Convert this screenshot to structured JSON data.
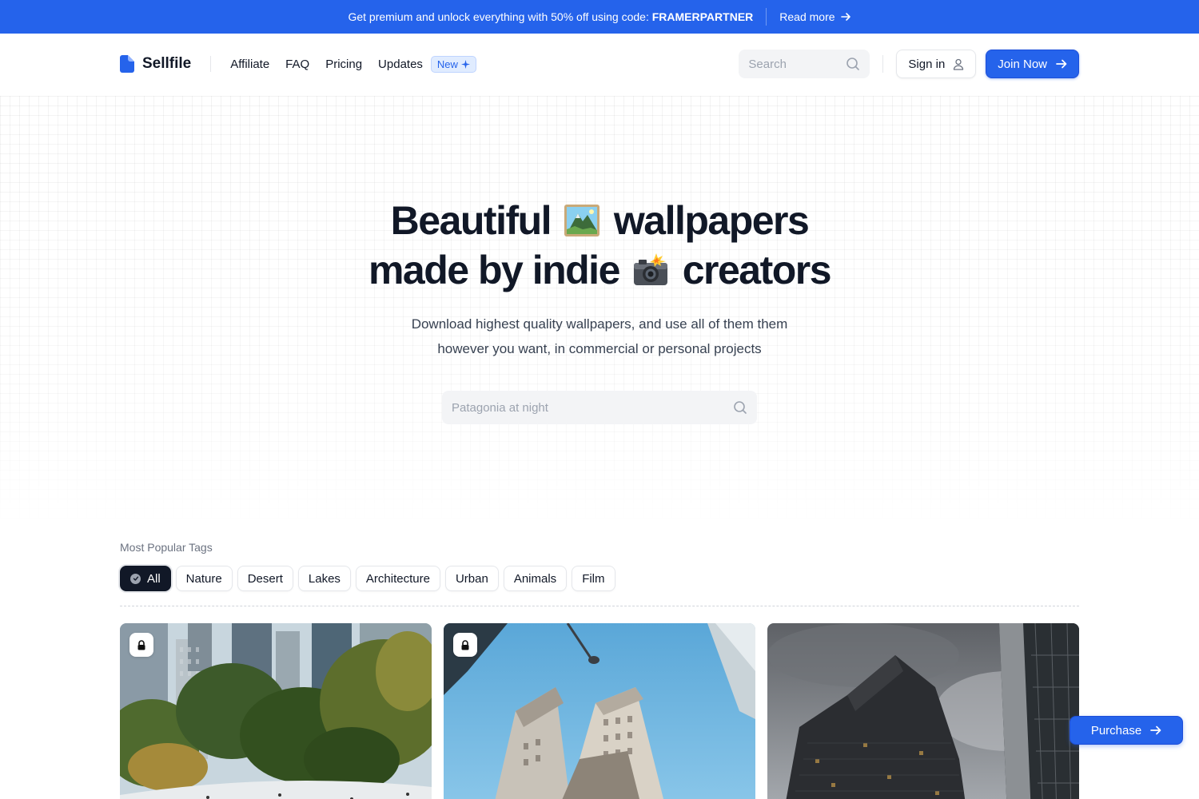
{
  "announcement": {
    "message": "Get premium and unlock everything with 50% off using code: ",
    "code": "FRAMERPARTNER",
    "read_more": "Read more"
  },
  "header": {
    "brand": "Sellfile",
    "nav": [
      {
        "label": "Affiliate"
      },
      {
        "label": "FAQ"
      },
      {
        "label": "Pricing"
      },
      {
        "label": "Updates"
      }
    ],
    "new_badge": "New",
    "search_placeholder": "Search",
    "sign_in": "Sign in",
    "join_now": "Join Now"
  },
  "hero": {
    "title_line1_a": "Beautiful",
    "title_line1_b": "wallpapers",
    "title_line2_a": "made by indie",
    "title_line2_b": "creators",
    "emoji1": "mountain-picture-icon",
    "emoji2": "camera-flash-icon",
    "subtitle_line1": "Download highest quality wallpapers, and use all of them them",
    "subtitle_line2": "however you want, in commercial or personal projects",
    "search_placeholder": "Patagonia at night"
  },
  "tags": {
    "title": "Most Popular Tags",
    "items": [
      "All",
      "Nature",
      "Desert",
      "Lakes",
      "Architecture",
      "Urban",
      "Animals",
      "Film"
    ],
    "active": "All"
  },
  "cards": [
    {
      "subject": "Central Park skating rink with skyscrapers",
      "locked": true
    },
    {
      "subject": "Looking up at city towers and street lamp",
      "locked": true
    },
    {
      "subject": "Dark glass office towers under cloudy sky",
      "locked": false
    }
  ],
  "purchase": "Purchase",
  "colors": {
    "accent": "#2563eb",
    "text": "#111827",
    "muted": "#6b7280"
  }
}
